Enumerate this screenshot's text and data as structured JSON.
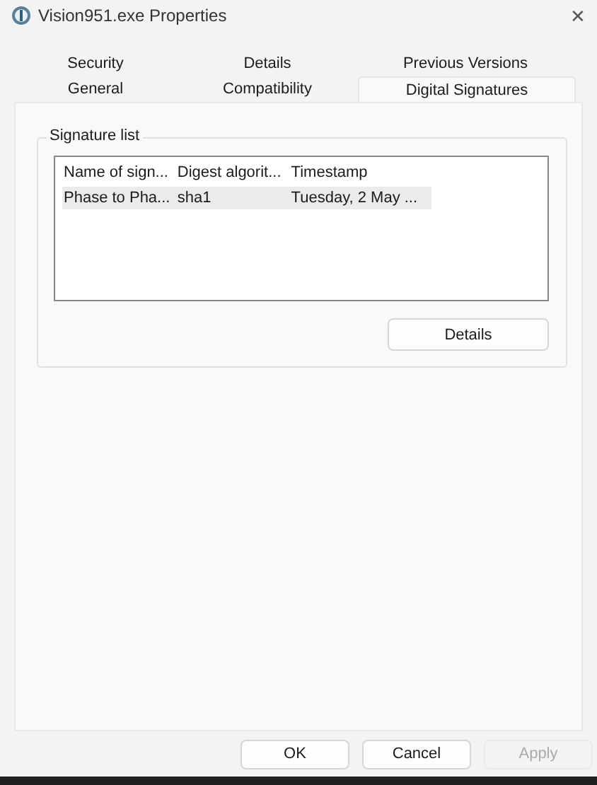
{
  "window": {
    "title": "Vision951.exe Properties",
    "close": "✕"
  },
  "tab_rows": [
    {
      "tabs": [
        {
          "label": "Security",
          "selected": false
        },
        {
          "label": "Details",
          "selected": false
        },
        {
          "label": "Previous Versions",
          "selected": false
        }
      ]
    },
    {
      "tabs": [
        {
          "label": "General",
          "selected": false
        },
        {
          "label": "Compatibility",
          "selected": false
        },
        {
          "label": "Digital Signatures",
          "selected": true
        }
      ]
    }
  ],
  "signature_list": {
    "title": "Signature list",
    "columns": [
      "Name of sign...",
      "Digest algorit...",
      "Timestamp"
    ],
    "rows": [
      {
        "cells": [
          "Phase to Pha...",
          "sha1",
          "Tuesday, 2 May ..."
        ],
        "selected": true
      }
    ],
    "details_button": "Details"
  },
  "buttons": [
    {
      "label": "OK",
      "disabled": false
    },
    {
      "label": "Cancel",
      "disabled": false
    },
    {
      "label": "Apply",
      "disabled": true
    }
  ]
}
